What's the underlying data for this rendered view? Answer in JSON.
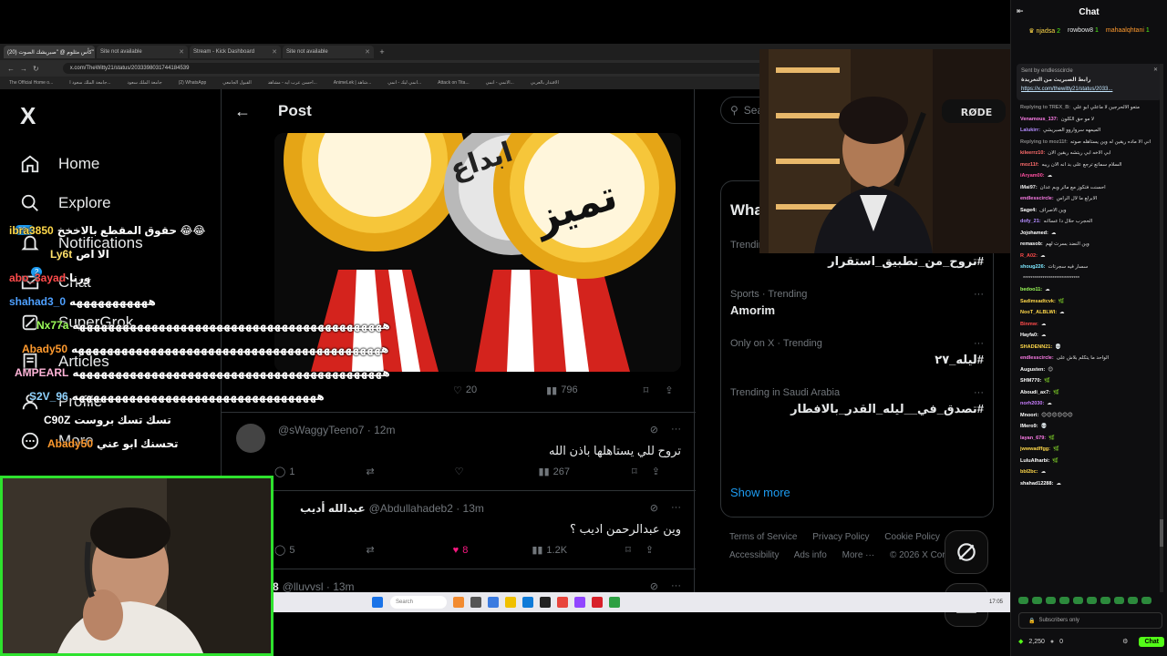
{
  "browser": {
    "tabs": [
      {
        "label": "(20) كأس مثلوم @ \"صبريشك الصوت\"",
        "active": true
      },
      {
        "label": "Site not available",
        "active": false
      },
      {
        "label": "Stream - Kick Dashboard",
        "active": false
      },
      {
        "label": "Site not available",
        "active": false
      }
    ],
    "url": "x.com/TheWitty21/status/2033398031744184539",
    "bookmarks": [
      "The Official Home o...",
      "جامعة الملك سعود ا...",
      "جامعة الملك سعود",
      "(2) WhatsApp",
      "القبول الجامعي",
      "احسن عرب ايه - مشاهد...",
      "AnimeLek | شاهد...",
      "انمي ليك - انمي...",
      "Attack on Tita...",
      "الانمي - انمي...",
      "الاقتدار بالعربي"
    ]
  },
  "x": {
    "logo": "X",
    "nav": [
      {
        "label": "Home",
        "icon": "home-icon"
      },
      {
        "label": "Explore",
        "icon": "search-icon"
      },
      {
        "label": "Notifications",
        "icon": "bell-icon",
        "badge": "20+"
      },
      {
        "label": "Chat",
        "icon": "mail-icon",
        "badge": "2"
      },
      {
        "label": "SuperGrok",
        "icon": "grok-icon"
      },
      {
        "label": "Articles",
        "icon": "article-icon"
      },
      {
        "label": "Profile",
        "icon": "person-icon"
      },
      {
        "label": "More",
        "icon": "more-icon"
      }
    ],
    "post": {
      "back": "←",
      "title": "Post",
      "image_text": [
        "تميز",
        "ابداع"
      ],
      "stats": {
        "replies": "",
        "reposts": "",
        "likes": "20",
        "views": "796"
      }
    },
    "replies": [
      {
        "name": "",
        "handle": "@sWaggyTeeno7 · 12m",
        "text": "تروح للي يستاهلها باذن الله",
        "replies": "1",
        "reposts": "",
        "likes": "",
        "views": "267",
        "liked": false
      },
      {
        "name": "عبدالله أديب",
        "handle": "@Abdullahadeb2 · 13m",
        "text": "وين عبدالرحمن اديب ؟",
        "replies": "5",
        "reposts": "",
        "likes": "8",
        "views": "1.2K",
        "liked": true
      },
      {
        "name": "8",
        "handle": "@lluvvsl · 13m",
        "text": "",
        "replies": "",
        "reposts": "",
        "likes": "",
        "views": "",
        "liked": false
      }
    ],
    "search_placeholder": "Search",
    "trends_heading": "What's happening",
    "trends": [
      {
        "meta": "Trending",
        "topic": "#تروح_من_تطبيق_استقرار",
        "rtl": true
      },
      {
        "meta": "Sports · Trending",
        "topic": "Amorim",
        "rtl": false
      },
      {
        "meta": "Only on X · Trending",
        "topic": "#ليله_٢٧",
        "rtl": true
      },
      {
        "meta": "Trending in Saudi Arabia",
        "topic": "#تصدق_في__ليله_القدر_بالافطار",
        "rtl": true
      }
    ],
    "show_more": "Show more",
    "footer": [
      "Terms of Service",
      "Privacy Policy",
      "Cookie Policy",
      "Accessibility",
      "Ads info",
      "More ···",
      "© 2026 X Corp."
    ]
  },
  "overlay_chat": [
    {
      "name": "ibra3850",
      "msg": "حقوق المقطع بالاخخخ 😂😂",
      "color": "#ffd84a"
    },
    {
      "name": "Ly6t",
      "msg": "الا اص",
      "color": "#ffe16b"
    },
    {
      "name": "abo_3ayad",
      "msg": "ورنا",
      "color": "#ff4b4b"
    },
    {
      "name": "shahad3_0",
      "msg": "هههههههههههه",
      "color": "#4ea0ff"
    },
    {
      "name": "Nx77a",
      "msg": "هههههههههههههههههههههههههههههههههههههههههههه",
      "color": "#9dff5a"
    },
    {
      "name": "Abady50",
      "msg": "هههههههههههههههههههههههههههههههههههههههههههه",
      "color": "#ff9a2e"
    },
    {
      "name": "AMPEARL",
      "msg": "هههههههههههههههههههههههههههههههههههههههههههه",
      "color": "#ffb4d8"
    },
    {
      "name": "S2V_96",
      "msg": "ههههههههههههههههههههههههههههههههههه",
      "color": "#8fd3ff"
    },
    {
      "name": "C90Z",
      "msg": "تسك تسك بروست",
      "color": "#ffffff"
    },
    {
      "name": "Abady50",
      "msg": "تحسنك ابو عني",
      "color": "#ff9a2e"
    }
  ],
  "taskbar": {
    "search": "Search",
    "clock": "17:05"
  },
  "kick": {
    "header": "Chat",
    "leaders": [
      {
        "name": "njadsa",
        "count": "2",
        "color": "#ffd84a"
      },
      {
        "name": "rowbow8",
        "count": "1",
        "color": "#ffffff"
      },
      {
        "name": "mahaalqhtani",
        "count": "1",
        "color": "#ff9a2e"
      }
    ],
    "pinned_by": "Sent by endlesscircle",
    "pinned_text": "رابط الصبريث من التغريدة",
    "pinned_link": "https://x.com/thewitty21/status/2033...",
    "messages": [
      {
        "user": "Replying to TREX_B:",
        "text": "متعو الالحرجين لا ماعلي ابو علي",
        "color": "#888"
      },
      {
        "user": "Venamous_137:",
        "text": "لا مو حق الكلون",
        "color": "#ff7de9"
      },
      {
        "user": "Lalukirr:",
        "text": "الميمهه سرواروو الصبريشي",
        "color": "#b38cff"
      },
      {
        "user": "Replying to moz11f:",
        "text": "اني الا ماده ريقين له وين يستاهله صوته",
        "color": "#888"
      },
      {
        "user": "kileerrz10:",
        "text": "ابي الاخه ابي ريتشه ريقين الان",
        "color": "#ff6c6c"
      },
      {
        "user": "moz11f:",
        "text": "السلام سماتع ترجع على بد انه الان ريبه",
        "color": "#ff6c6c"
      },
      {
        "user": "iAryam00:",
        "text": "☁",
        "color": "#ff4fa0"
      },
      {
        "user": "iMai97:",
        "text": "احسنت فتكوز مع ماثر وبم عدان",
        "color": "#eeeeee"
      },
      {
        "user": "endlesscircle:",
        "text": "الابرلع ما لال الراس",
        "color": "#ff7de9"
      },
      {
        "user": "Sage4:",
        "text": "وين الاصراف",
        "color": "#ffffff"
      },
      {
        "user": "dofy_21:",
        "text": "الحجرب حلال دا عساانه",
        "color": "#b38cff"
      },
      {
        "user": "Jojohamed:",
        "text": "☁",
        "color": "#ffffff"
      },
      {
        "user": "remasob:",
        "text": "وين النضد بسرت لهم",
        "color": "#ffffff"
      },
      {
        "user": "R_A02:",
        "text": "☁",
        "color": "#ff4b4b"
      },
      {
        "user": "shoug226:",
        "text": "سسار فيه سجرتات",
        "color": "#7de7ff"
      },
      {
        "user": "",
        "text": "*****************************",
        "color": "#ffffff"
      },
      {
        "user": "bedoo11:",
        "text": "☁",
        "color": "#9dff5a"
      },
      {
        "user": "Sadimsadtcvk:",
        "text": "🌿",
        "color": "#ffd84a"
      },
      {
        "user": "NooT_ALBLWI:",
        "text": "☁",
        "color": "#ffd84a"
      },
      {
        "user": "Binmw:",
        "text": "☁",
        "color": "#ff4b4b"
      },
      {
        "user": "Hayfa0:",
        "text": "☁",
        "color": "#ffffff"
      },
      {
        "user": "SHADENN21:",
        "text": "💀",
        "color": "#ffd84a"
      },
      {
        "user": "endlesscircle:",
        "text": "الواحد ما يتكلم بلاش على",
        "color": "#ff7de9"
      },
      {
        "user": "Augusten:",
        "text": "😊",
        "color": "#ffffff"
      },
      {
        "user": "SHM770:",
        "text": "🌿",
        "color": "#ffffff"
      },
      {
        "user": "Aboudi_ax7:",
        "text": "🌿",
        "color": "#ffffff"
      },
      {
        "user": "norh2030:",
        "text": "☁",
        "color": "#c97dff"
      },
      {
        "user": "Mnoori:",
        "text": "😊😊😊😊😊😊",
        "color": "#ffffff"
      },
      {
        "user": "IMero9:",
        "text": "💀",
        "color": "#ffffff"
      },
      {
        "user": "layan_679:",
        "text": "🌿",
        "color": "#ff7de9"
      },
      {
        "user": "jwwwadffgg:",
        "text": "🌿",
        "color": "#ffd84a"
      },
      {
        "user": "LuluAlharbi:",
        "text": "🌿",
        "color": "#ffffff"
      },
      {
        "user": "bbl2bc:",
        "text": "☁",
        "color": "#ffd84a"
      },
      {
        "user": "shahad12288:",
        "text": "☁",
        "color": "#ffffff"
      }
    ],
    "sub_only": "Subscribers only",
    "viewers": "2,250",
    "points": "0",
    "chat_button": "Chat",
    "accent": "#53fc18"
  },
  "cam": {
    "mic_brand": "RØDE"
  }
}
